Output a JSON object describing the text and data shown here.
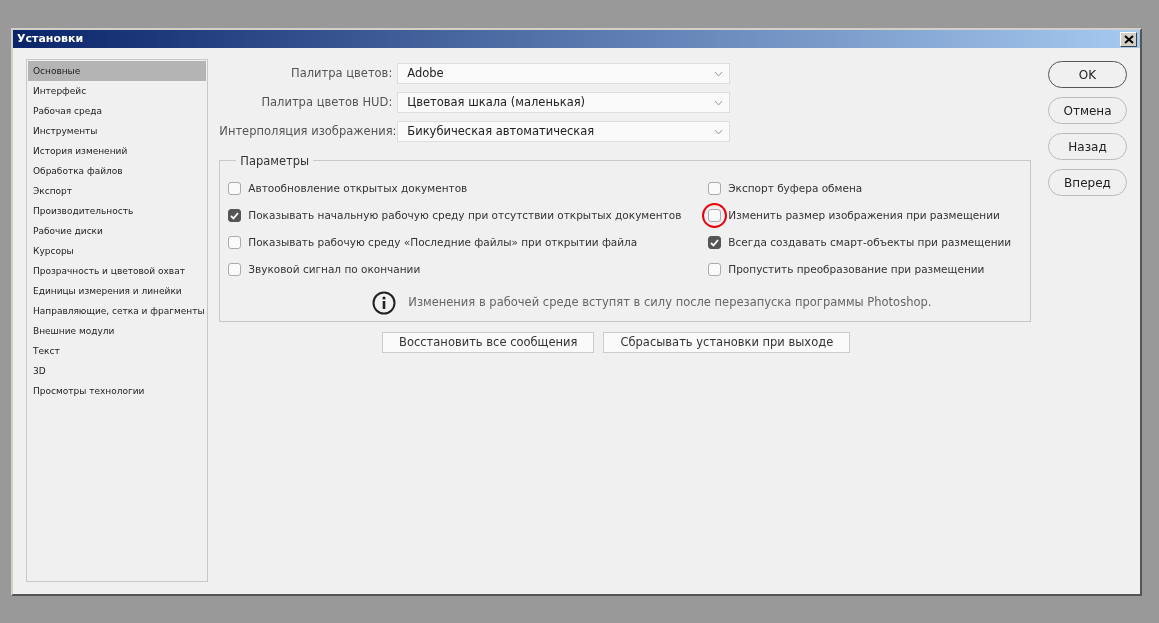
{
  "window": {
    "title": "Установки"
  },
  "sidebar": {
    "items": [
      {
        "label": "Основные",
        "selected": true
      },
      {
        "label": "Интерфейс",
        "selected": false
      },
      {
        "label": "Рабочая среда",
        "selected": false
      },
      {
        "label": "Инструменты",
        "selected": false
      },
      {
        "label": "История изменений",
        "selected": false
      },
      {
        "label": "Обработка файлов",
        "selected": false
      },
      {
        "label": "Экспорт",
        "selected": false
      },
      {
        "label": "Производительность",
        "selected": false
      },
      {
        "label": "Рабочие диски",
        "selected": false
      },
      {
        "label": "Курсоры",
        "selected": false
      },
      {
        "label": "Прозрачность и цветовой охват",
        "selected": false
      },
      {
        "label": "Единицы измерения и линейки",
        "selected": false
      },
      {
        "label": "Направляющие, сетка и фрагменты",
        "selected": false
      },
      {
        "label": "Внешние модули",
        "selected": false
      },
      {
        "label": "Текст",
        "selected": false
      },
      {
        "label": "3D",
        "selected": false
      },
      {
        "label": "Просмотры технологии",
        "selected": false
      }
    ]
  },
  "dropdowns": [
    {
      "label": "Палитра цветов:",
      "value": "Adobe"
    },
    {
      "label": "Палитра цветов HUD:",
      "value": "Цветовая шкала (маленькая)"
    },
    {
      "label": "Интерполяция изображения:",
      "value": "Бикубическая автоматическая"
    }
  ],
  "options": {
    "title": "Параметры",
    "left": [
      {
        "label": "Автообновление открытых документов",
        "checked": false,
        "highlighted": false
      },
      {
        "label": "Показывать начальную рабочую среду при отсутствии открытых документов",
        "checked": true,
        "highlighted": false
      },
      {
        "label": "Показывать рабочую среду «Последние файлы» при открытии файла",
        "checked": false,
        "highlighted": false
      },
      {
        "label": "Звуковой сигнал по окончании",
        "checked": false,
        "highlighted": false
      }
    ],
    "right": [
      {
        "label": "Экспорт буфера обмена",
        "checked": false,
        "highlighted": false
      },
      {
        "label": "Изменить размер изображения при размещении",
        "checked": false,
        "highlighted": true
      },
      {
        "label": "Всегда создавать смарт-объекты при размещении",
        "checked": true,
        "highlighted": false
      },
      {
        "label": "Пропустить преобразование при размещении",
        "checked": false,
        "highlighted": false
      }
    ],
    "note": "Изменения в рабочей среде вступят в силу после перезапуска программы Photoshop."
  },
  "bottom_buttons": [
    "Восстановить все сообщения",
    "Сбрасывать установки при выходе"
  ],
  "side_buttons": [
    {
      "label": "OK",
      "default": true
    },
    {
      "label": "Отмена",
      "default": false
    },
    {
      "label": "Назад",
      "default": false
    },
    {
      "label": "Вперед",
      "default": false
    }
  ]
}
